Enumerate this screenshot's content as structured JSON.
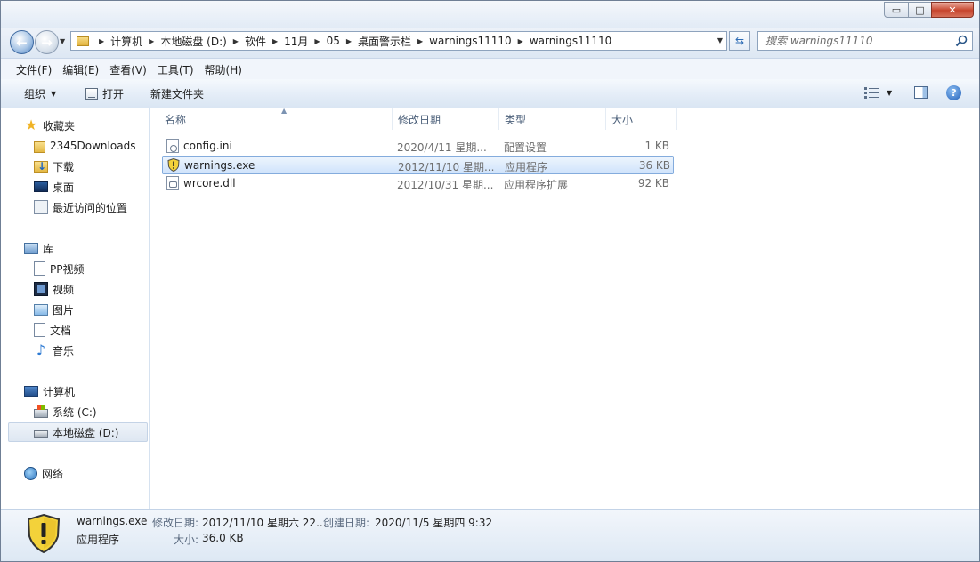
{
  "window": {
    "minimize": "▭",
    "maximize": "□",
    "close": "✕"
  },
  "navigation": {
    "back": "←",
    "forward": "→",
    "breadcrumbs": [
      "计算机",
      "本地磁盘 (D:)",
      "软件",
      "11月",
      "05",
      "桌面警示栏",
      "warnings11110",
      "warnings11110"
    ],
    "search_placeholder": "搜索 warnings11110"
  },
  "menu": {
    "items": [
      "文件(F)",
      "编辑(E)",
      "查看(V)",
      "工具(T)",
      "帮助(H)"
    ]
  },
  "toolbar": {
    "organize_label": "组织",
    "open_label": "打开",
    "new_folder_label": "新建文件夹"
  },
  "sidebar": {
    "favorites_label": "收藏夹",
    "favorites": [
      "2345Downloads",
      "下载",
      "桌面",
      "最近访问的位置"
    ],
    "libraries_label": "库",
    "libraries": [
      "PP视频",
      "视频",
      "图片",
      "文档",
      "音乐"
    ],
    "computer_label": "计算机",
    "drives": [
      "系统 (C:)",
      "本地磁盘 (D:)"
    ],
    "network_label": "网络"
  },
  "file_list": {
    "columns": [
      "名称",
      "修改日期",
      "类型",
      "大小"
    ],
    "rows": [
      {
        "name": "config.ini",
        "date": "2020/4/11 星期...",
        "type": "配置设置",
        "size": "1 KB"
      },
      {
        "name": "warnings.exe",
        "date": "2012/11/10 星期...",
        "type": "应用程序",
        "size": "36 KB"
      },
      {
        "name": "wrcore.dll",
        "date": "2012/10/31 星期...",
        "type": "应用程序扩展",
        "size": "92 KB"
      }
    ]
  },
  "details": {
    "file_name": "warnings.exe",
    "file_type": "应用程序",
    "modified_label": "修改日期:",
    "modified_value": "2012/11/10 星期六 22...",
    "created_label": "创建日期:",
    "created_value": "2020/11/5 星期四 9:32",
    "size_label": "大小:",
    "size_value": "36.0 KB"
  },
  "colors": {
    "selection": "#cfe3fb",
    "accent": "#2d6cb5",
    "close_button": "#c7452d"
  }
}
